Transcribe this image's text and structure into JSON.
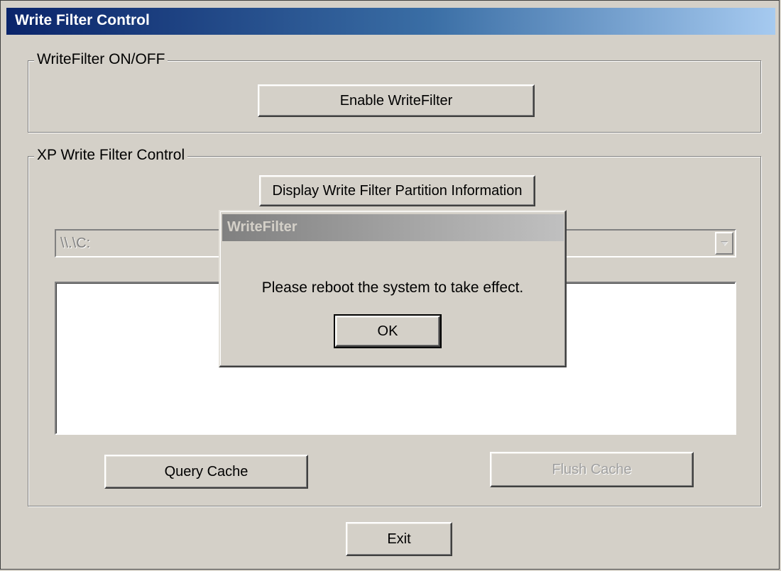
{
  "window": {
    "title": "Write Filter Control"
  },
  "onoff_group": {
    "label": "WriteFilter ON/OFF",
    "enable_button": "Enable WriteFilter"
  },
  "control_group": {
    "label": "XP Write Filter Control",
    "display_button": "Display Write Filter Partition Information",
    "partition_select": {
      "value": "\\\\.\\C:",
      "disabled": true
    },
    "query_button": "Query Cache",
    "flush_button": "Flush Cache",
    "flush_disabled": true
  },
  "exit_button": "Exit",
  "dialog": {
    "title": "WriteFilter",
    "message": "Please reboot the system to take effect.",
    "ok_button": "OK"
  },
  "colors": {
    "face": "#d4d0c8",
    "active_title": "#0a246a",
    "inactive_title": "#808080"
  }
}
